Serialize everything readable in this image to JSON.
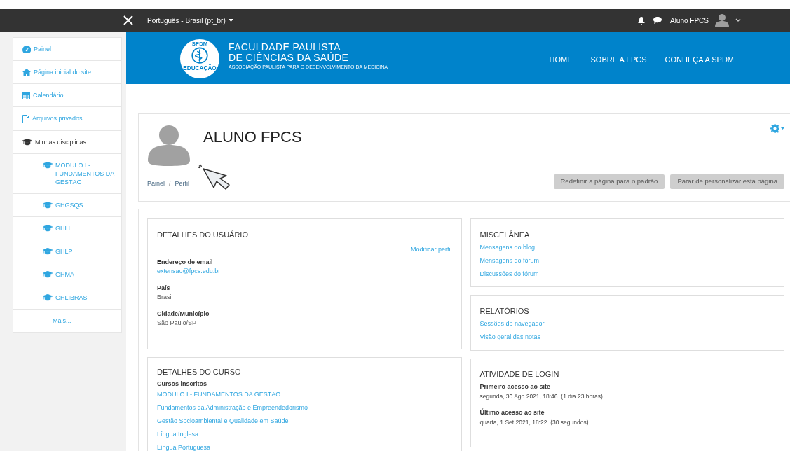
{
  "topbar": {
    "language": "Português - Brasil (pt_br)",
    "user_name": "Aluno FPCS"
  },
  "header": {
    "logo_top": "SPDM",
    "logo_bottom": "EDUCAÇÃO",
    "title_line1": "FACULDADE PAULISTA",
    "title_line2": "DE CIÊNCIAS DA SAÚDE",
    "subtitle": "ASSOCIAÇÃO PAULISTA PARA O DESENVOLVIMENTO DA MEDICINA",
    "nav": [
      "HOME",
      "SOBRE A FPCS",
      "CONHEÇA A SPDM"
    ]
  },
  "sidebar": {
    "items": [
      {
        "label": "Painel",
        "kind": "dashboard"
      },
      {
        "label": "Página inicial do site",
        "kind": "home"
      },
      {
        "label": "Calendário",
        "kind": "calendar"
      },
      {
        "label": "Arquivos privados",
        "kind": "file"
      },
      {
        "label": "Minhas disciplinas",
        "kind": "heading",
        "children": [
          {
            "label": "MÓDULO I - FUNDAMENTOS DA GESTÃO",
            "kind": "course"
          },
          {
            "label": "GHGSQS",
            "kind": "course"
          },
          {
            "label": "GHLI",
            "kind": "course"
          },
          {
            "label": "GHLP",
            "kind": "course"
          },
          {
            "label": "GHMA",
            "kind": "course"
          },
          {
            "label": "GHLIBRAS",
            "kind": "course"
          },
          {
            "label": "Mais...",
            "kind": "more"
          }
        ]
      }
    ]
  },
  "profile": {
    "name": "ALUNO FPCS",
    "breadcrumb": [
      "Painel",
      "Perfil"
    ],
    "breadcrumb_separator": "/",
    "buttons": [
      "Redefinir a página para o padrão",
      "Parar de personalizar esta página"
    ]
  },
  "user_details": {
    "title": "DETALHES DO USUÁRIO",
    "edit_link": "Modificar perfil",
    "fields": [
      {
        "label": "Endereço de email",
        "value": "extensao@fpcs.edu.br",
        "kind": "link"
      },
      {
        "label": "País",
        "value": "Brasil",
        "kind": "text"
      },
      {
        "label": "Cidade/Município",
        "value": "São Paulo/SP",
        "kind": "text"
      }
    ]
  },
  "course_details": {
    "title": "DETALHES DO CURSO",
    "label": "Cursos inscritos",
    "courses": [
      "MÓDULO I - FUNDAMENTOS DA GESTÃO",
      "Fundamentos da Administração e Empreendedorismo",
      "Gestão Socioambiental e Qualidade em Saúde",
      "Língua Inglesa",
      "Língua Portuguesa"
    ]
  },
  "miscellany": {
    "title": "MISCELÂNEA",
    "links": [
      "Mensagens do blog",
      "Mensagens do fórum",
      "Discussões do fórum"
    ]
  },
  "reports": {
    "title": "RELATÓRIOS",
    "links": [
      "Sessões do navegador",
      "Visão geral das notas"
    ]
  },
  "login_activity": {
    "title": "ATIVIDADE DE LOGIN",
    "fields": [
      {
        "label": "Primeiro acesso ao site",
        "value": "segunda, 30 Ago 2021, 18:46  (1 dia 23 horas)"
      },
      {
        "label": "Último acesso ao site",
        "value": "quarta, 1 Set 2021, 18:22  (30 segundos)"
      }
    ]
  }
}
